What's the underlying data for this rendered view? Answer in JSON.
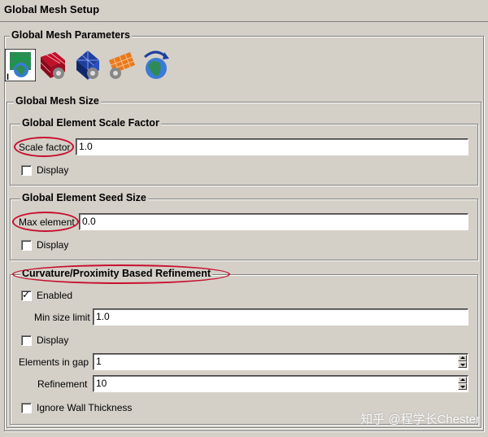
{
  "window": {
    "title": "Global Mesh Setup"
  },
  "parameters": {
    "legend": "Global Mesh Parameters",
    "icons": [
      "mesh-size-globe-icon",
      "red-mesh-gear-icon",
      "blue-mesh-gear-icon",
      "orange-mesh-gear-icon",
      "globe-arrow-icon"
    ]
  },
  "mesh_size": {
    "legend": "Global Mesh Size",
    "scale_factor": {
      "legend": "Global Element Scale Factor",
      "label": "Scale factor",
      "value": "1.0",
      "display_label": "Display",
      "display_checked": false
    },
    "seed_size": {
      "legend": "Global Element Seed Size",
      "label": "Max element",
      "value": "0.0",
      "display_label": "Display",
      "display_checked": false
    },
    "refinement": {
      "legend": "Curvature/Proximity Based Refinement",
      "enabled_label": "Enabled",
      "enabled_checked": true,
      "min_size_label": "Min size limit",
      "min_size_value": "1.0",
      "display_label": "Display",
      "display_checked": false,
      "elements_gap_label": "Elements in gap",
      "elements_gap_value": "1",
      "refinement_label": "Refinement",
      "refinement_value": "10",
      "ignore_wall_label": "Ignore Wall Thickness",
      "ignore_wall_checked": false
    }
  },
  "colors": {
    "annotation_red": "#c8102e",
    "panel": "#d4d0c8"
  },
  "watermark": "知乎 @程学长Chester"
}
